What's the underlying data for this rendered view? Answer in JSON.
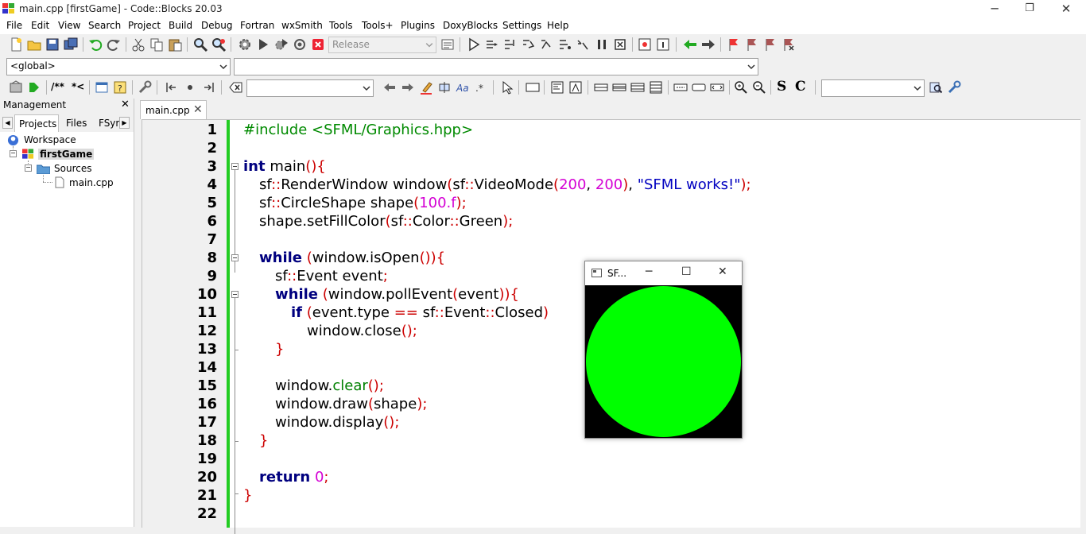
{
  "window": {
    "title": "main.cpp [firstGame] - Code::Blocks 20.03",
    "minimize": "─",
    "restore": "❐",
    "close": "✕"
  },
  "menu": [
    "File",
    "Edit",
    "View",
    "Search",
    "Project",
    "Build",
    "Debug",
    "Fortran",
    "wxSmith",
    "Tools",
    "Tools+",
    "Plugins",
    "DoxyBlocks",
    "Settings",
    "Help"
  ],
  "toolbar": {
    "build_target": "Release",
    "scope": "<global>",
    "function": "",
    "search_text": "",
    "doxy_comment": "/**",
    "doxy_line": "*<",
    "bold_s": "S",
    "bold_c": "C"
  },
  "management": {
    "title": "Management",
    "close": "✕",
    "tabs": [
      "Projects",
      "Files",
      "FSym"
    ],
    "tree": {
      "workspace": "Workspace",
      "project": "firstGame",
      "folder": "Sources",
      "file": "main.cpp"
    }
  },
  "editor": {
    "tab_label": "main.cpp",
    "tab_close": "✕",
    "line_numbers": [
      "1",
      "2",
      "3",
      "4",
      "5",
      "6",
      "7",
      "8",
      "9",
      "10",
      "11",
      "12",
      "13",
      "14",
      "15",
      "16",
      "17",
      "18",
      "19",
      "20",
      "21",
      "22"
    ]
  },
  "sfml": {
    "title": "SF...",
    "minimize": "─",
    "maximize": "☐",
    "close": "✕",
    "circle_color": "#00ff00",
    "background": "#000000"
  },
  "colors": {
    "accent_green_bar": "#22cc22",
    "keyword": "#00007f",
    "preprocessor": "#008a00",
    "operator": "#cc0000",
    "number": "#d400d4",
    "string": "#0000c0"
  }
}
